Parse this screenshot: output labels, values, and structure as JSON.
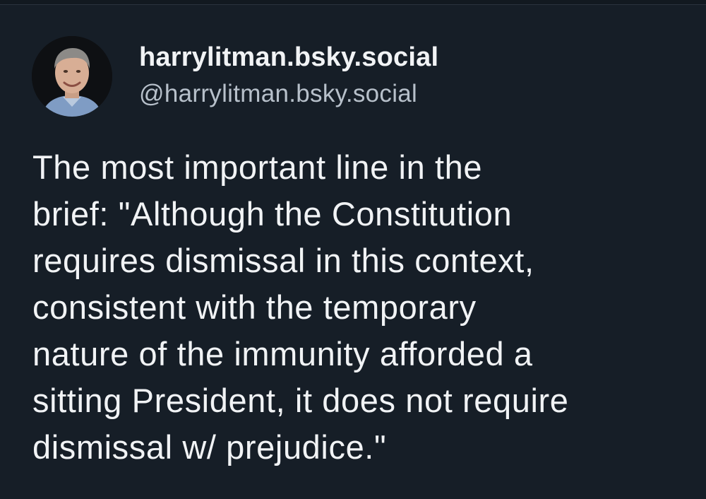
{
  "post": {
    "author": {
      "display_name": "harrylitman.bsky.social",
      "handle": "@harrylitman.bsky.social",
      "avatar_icon": "profile-photo"
    },
    "text_lines": [
      "The most important line in the",
      "brief: \"Although the Constitution",
      "requires dismissal in this context,",
      "consistent with the temporary",
      "nature of the immunity afforded a",
      "sitting President, it does not require",
      "dismissal w/ prejudice.\""
    ]
  },
  "colors": {
    "background": "#161e27",
    "text": "#f1f3f5",
    "handle_text": "#b7c0ca"
  }
}
